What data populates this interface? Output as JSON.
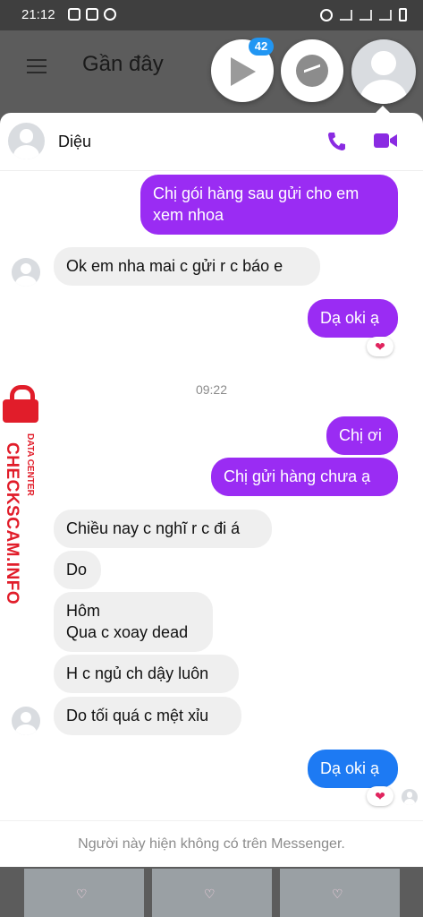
{
  "status_bar": {
    "time": "21:12"
  },
  "top_bar": {
    "title": "Gần đây"
  },
  "chat_heads": {
    "badge": "42"
  },
  "chat": {
    "contact_name": "Diệu",
    "messages": [
      {
        "dir": "out",
        "text": "Chị gói hàng sau gửi cho em xem nhoa"
      },
      {
        "dir": "in",
        "text": "Ok em nha mai c gửi r c báo e"
      },
      {
        "dir": "out",
        "text": "Dạ oki ạ",
        "reaction": "❤"
      },
      {
        "dir": "out",
        "text": "Chị ơi"
      },
      {
        "dir": "out",
        "text": "Chị gửi hàng chưa ạ"
      },
      {
        "dir": "in",
        "text": "Chiều nay c nghĩ r c đi á"
      },
      {
        "dir": "in",
        "text": "Do"
      },
      {
        "dir": "in",
        "text": "Hôm\nQua c xoay dead"
      },
      {
        "dir": "in",
        "text": "H c ngủ ch dậy luôn"
      },
      {
        "dir": "in",
        "text": "Do tối quá c mệt xỉu"
      },
      {
        "dir": "out",
        "text": "Dạ oki ạ",
        "reaction": "❤"
      }
    ],
    "timestamp": "09:22",
    "footer_notice": "Người này hiện không có trên Messenger."
  },
  "watermark": {
    "brand": "CHECKSCAM.INFO",
    "sub": "DATA CENTER"
  },
  "colors": {
    "outgoing": "#9a2cf3",
    "outgoing_last": "#1d7af3",
    "incoming": "#efefef",
    "accent": "#8a2be2"
  }
}
